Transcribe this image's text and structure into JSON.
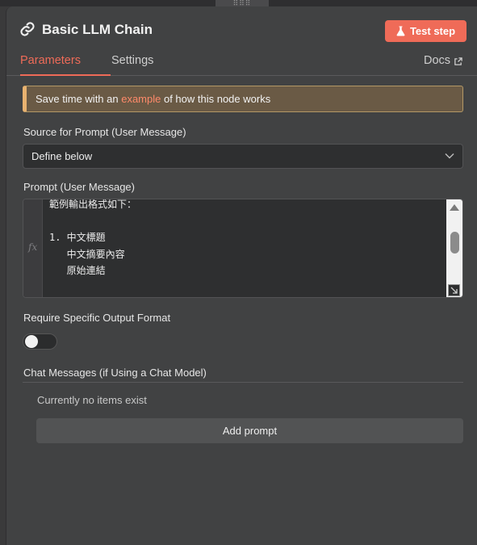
{
  "header": {
    "title": "Basic LLM Chain",
    "test_button_label": "Test step",
    "link_icon": "link-icon",
    "flask_icon": "flask-icon"
  },
  "tabs": [
    {
      "label": "Parameters",
      "active": true
    },
    {
      "label": "Settings",
      "active": false
    }
  ],
  "docs_label": "Docs",
  "notice": {
    "prefix": "Save time with an ",
    "link": "example",
    "suffix": " of how this node works"
  },
  "source_prompt": {
    "label": "Source for Prompt (User Message)",
    "value": "Define below"
  },
  "prompt": {
    "label": "Prompt (User Message)",
    "expression_icon": "fx",
    "text": "範例輸出格式如下：\n\n1. 中文標題\n   中文摘要內容\n   原始連結"
  },
  "output_format": {
    "label": "Require Specific Output Format",
    "enabled": false
  },
  "chat_messages": {
    "label": "Chat Messages (if Using a Chat Model)",
    "empty_text": "Currently no items exist",
    "add_button_label": "Add prompt"
  },
  "colors": {
    "accent": "#ef6b58",
    "panel_bg": "#414243",
    "notice_bg": "#6a5a45"
  }
}
